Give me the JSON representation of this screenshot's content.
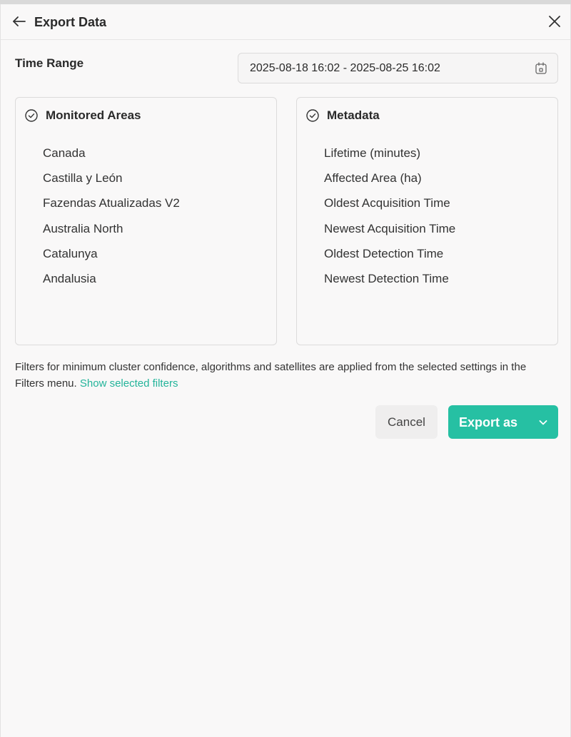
{
  "header": {
    "title": "Export Data"
  },
  "time_range": {
    "label": "Time Range",
    "value": "2025-08-18 16:02 - 2025-08-25 16:02"
  },
  "monitored_areas": {
    "title": "Monitored Areas",
    "items": [
      "Canada",
      "Castilla y León",
      "Fazendas Atualizadas V2",
      "Australia North",
      "Catalunya",
      "Andalusia"
    ]
  },
  "metadata": {
    "title": "Metadata",
    "items": [
      "Lifetime (minutes)",
      "Affected Area (ha)",
      "Oldest Acquisition Time",
      "Newest Acquisition Time",
      "Oldest Detection Time",
      "Newest Detection Time"
    ]
  },
  "info": {
    "text": "Filters for minimum cluster confidence, algorithms and satellites are applied from the selected settings in the Filters menu.",
    "link": "Show selected filters"
  },
  "actions": {
    "cancel": "Cancel",
    "export": "Export as"
  },
  "colors": {
    "accent": "#26c0a3",
    "link": "#23b49a"
  }
}
